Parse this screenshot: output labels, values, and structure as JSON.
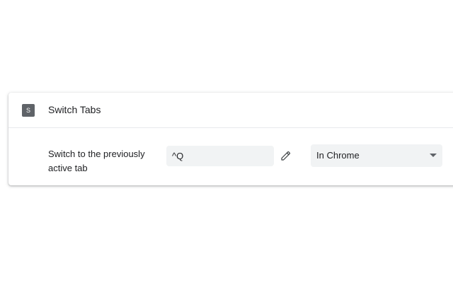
{
  "extension": {
    "icon_letter": "S",
    "icon_name": "extension-letter-icon",
    "title": "Switch Tabs"
  },
  "shortcut": {
    "label": "Switch to the previously active tab",
    "value": "^Q",
    "edit_icon": "pencil-icon"
  },
  "scope": {
    "selected": "In Chrome"
  },
  "colors": {
    "icon_bg": "#5f6368",
    "field_bg": "#f1f3f4",
    "text": "#202124"
  }
}
